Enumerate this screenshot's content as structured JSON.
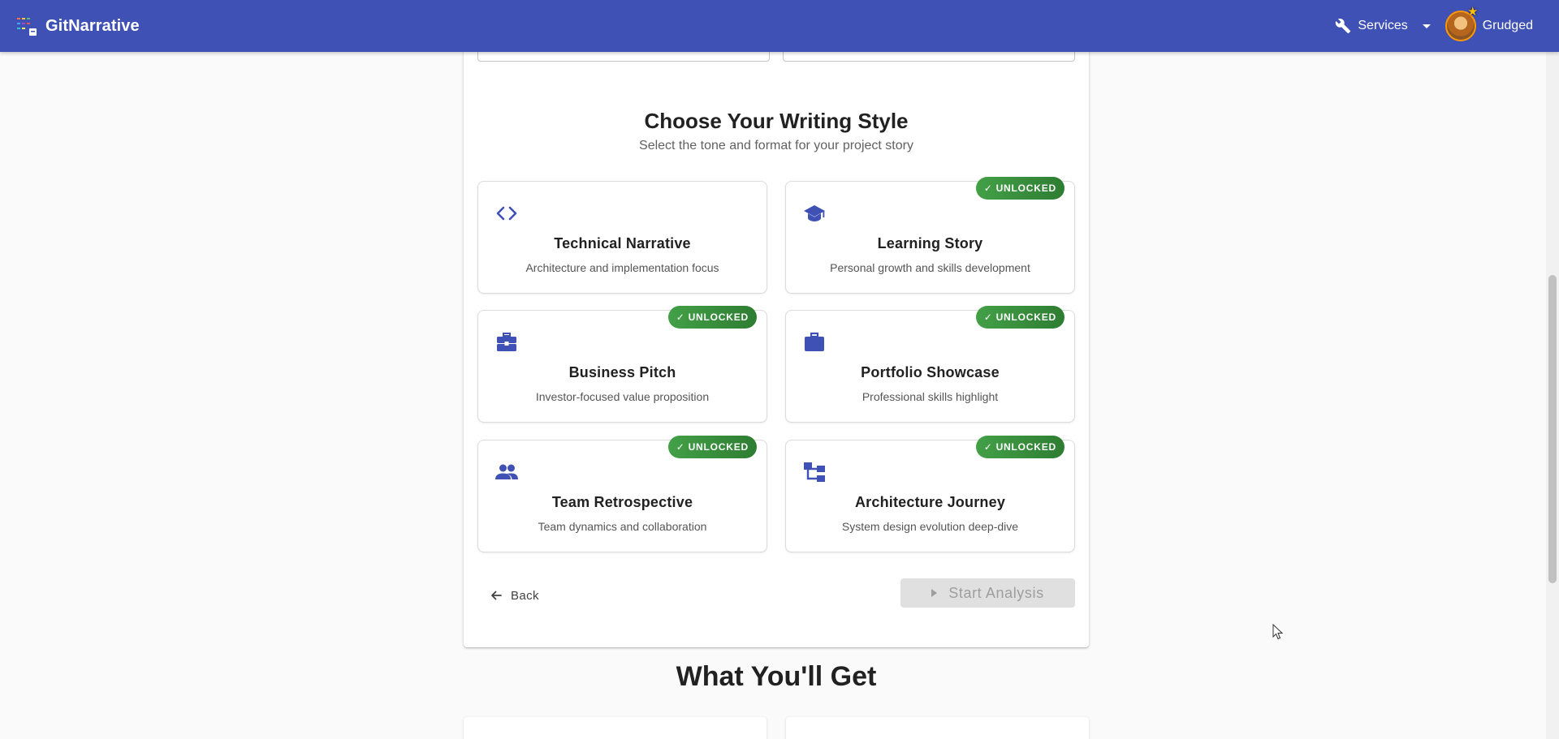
{
  "app": {
    "name": "GitNarrative"
  },
  "nav": {
    "services_label": "Services",
    "user_name": "Grudged"
  },
  "section": {
    "title": "Choose Your Writing Style",
    "subtitle": "Select the tone and format for your project story"
  },
  "styles": [
    {
      "title": "Technical Narrative",
      "desc": "Architecture and implementation focus",
      "icon": "code-icon",
      "badge": ""
    },
    {
      "title": "Learning Story",
      "desc": "Personal growth and skills development",
      "icon": "graduation-cap-icon",
      "badge": "UNLOCKED"
    },
    {
      "title": "Business Pitch",
      "desc": "Investor-focused value proposition",
      "icon": "briefcase-plus-icon",
      "badge": "UNLOCKED"
    },
    {
      "title": "Portfolio Showcase",
      "desc": "Professional skills highlight",
      "icon": "work-bag-icon",
      "badge": "UNLOCKED"
    },
    {
      "title": "Team Retrospective",
      "desc": "Team dynamics and collaboration",
      "icon": "people-icon",
      "badge": "UNLOCKED"
    },
    {
      "title": "Architecture Journey",
      "desc": "System design evolution deep-dive",
      "icon": "hierarchy-icon",
      "badge": "UNLOCKED"
    }
  ],
  "actions": {
    "back_label": "Back",
    "start_label": "Start Analysis"
  },
  "features": {
    "title": "What You'll Get"
  },
  "colors": {
    "primary": "#3f51b5",
    "badge": "#388e3c",
    "disabled": "#e0e0e0"
  }
}
